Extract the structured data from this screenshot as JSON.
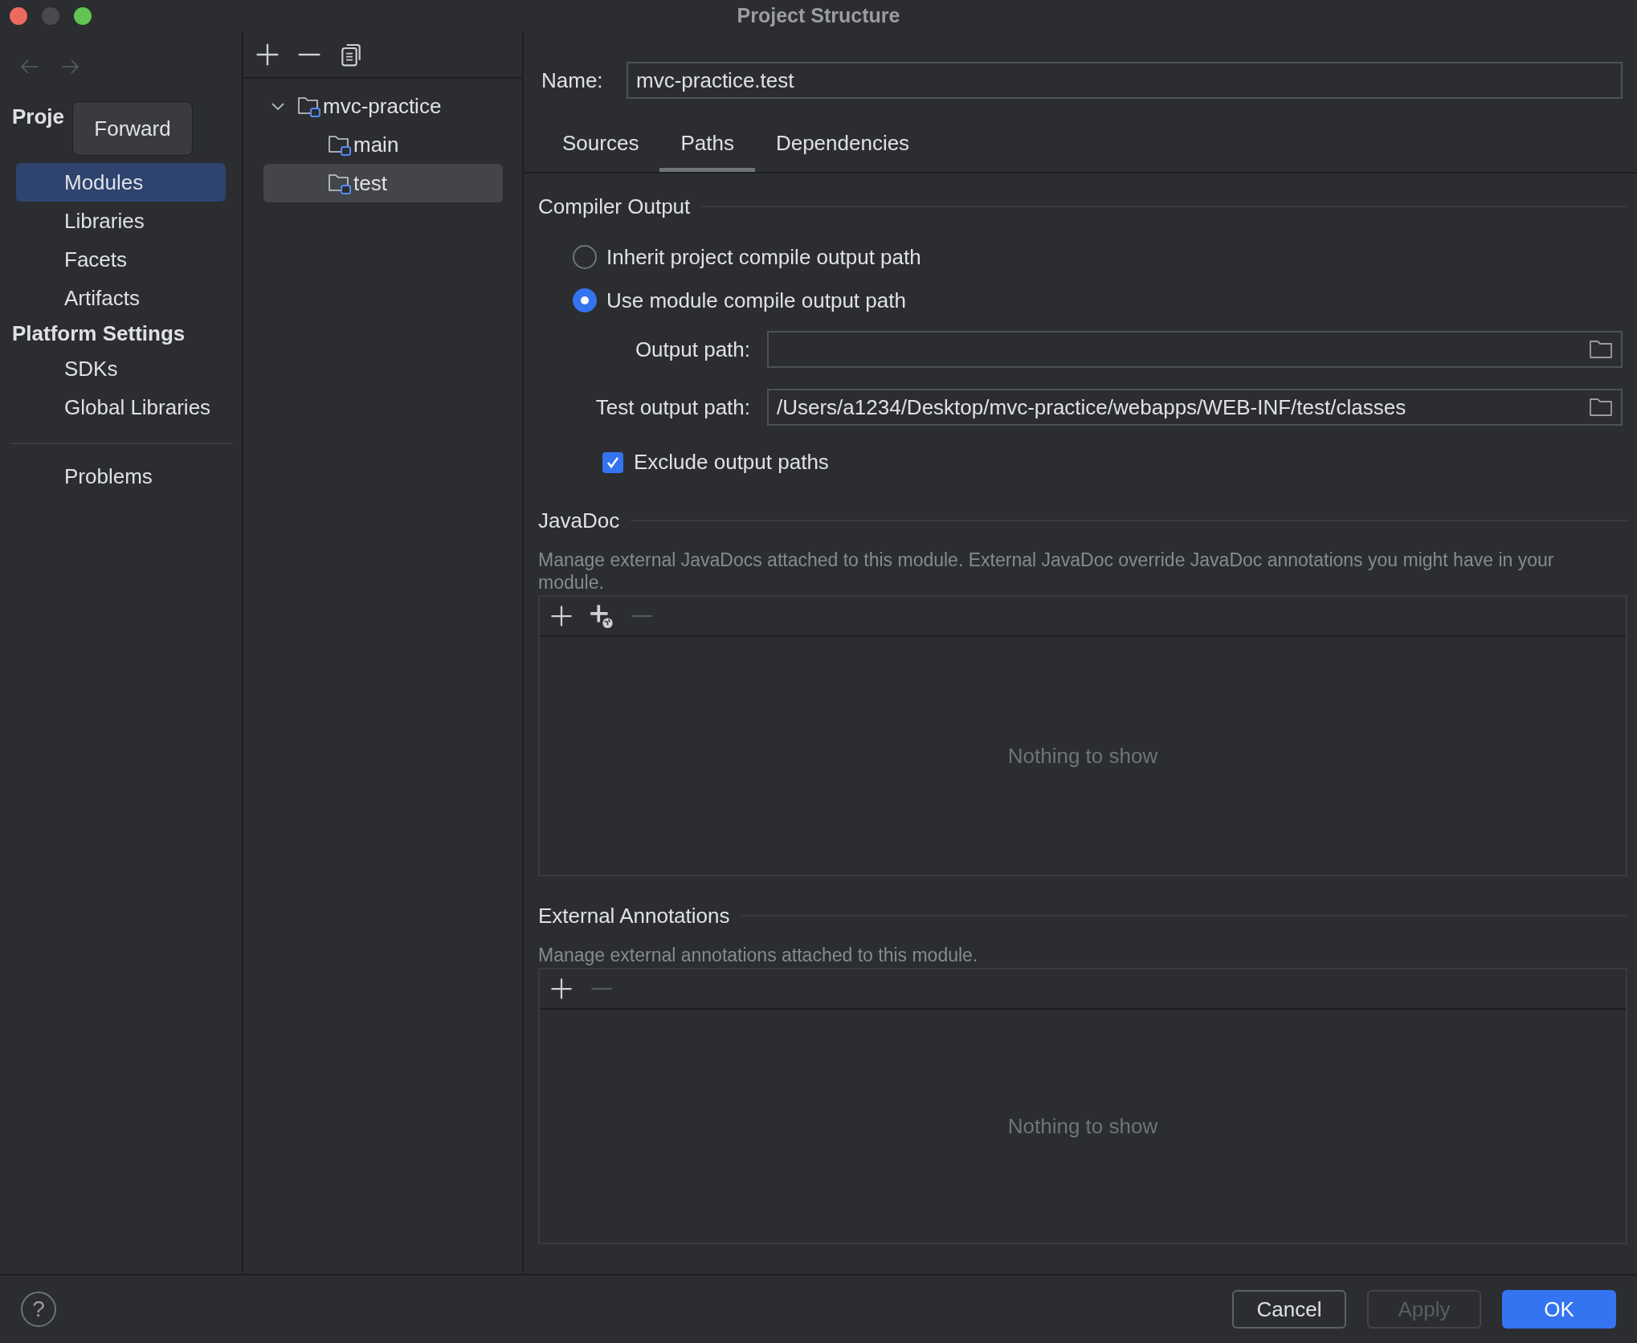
{
  "window": {
    "title": "Project Structure"
  },
  "nav": [
    {
      "kind": "back",
      "disabled": true
    },
    {
      "kind": "forward",
      "disabled": true
    }
  ],
  "tooltip": "Forward",
  "sidebar": {
    "sections": [
      {
        "header": "Proje",
        "items": [
          {
            "label": "Modules",
            "selected": true
          },
          {
            "label": "Libraries",
            "selected": false
          },
          {
            "label": "Facets",
            "selected": false
          },
          {
            "label": "Artifacts",
            "selected": false
          }
        ]
      },
      {
        "header": "Platform Settings",
        "items": [
          {
            "label": "SDKs",
            "selected": false
          },
          {
            "label": "Global Libraries",
            "selected": false
          }
        ]
      }
    ],
    "footer_items": [
      {
        "label": "Problems",
        "selected": false
      }
    ]
  },
  "tree": {
    "toolbar": [
      {
        "kind": "add",
        "disabled": false
      },
      {
        "kind": "remove",
        "disabled": false
      },
      {
        "kind": "copy",
        "disabled": false
      }
    ],
    "nodes": [
      {
        "label": "mvc-practice",
        "expanded": true,
        "selected": false,
        "children": [
          {
            "label": "main",
            "selected": false
          },
          {
            "label": "test",
            "selected": true
          }
        ]
      }
    ]
  },
  "name_field": {
    "label": "Name:",
    "value": "mvc-practice.test"
  },
  "tabs": [
    {
      "label": "Sources",
      "selected": false
    },
    {
      "label": "Paths",
      "selected": true
    },
    {
      "label": "Dependencies",
      "selected": false
    }
  ],
  "compiler_output": {
    "title": "Compiler Output",
    "options": [
      {
        "label": "Inherit project compile output path",
        "selected": false
      },
      {
        "label": "Use module compile output path",
        "selected": true
      }
    ],
    "fields": [
      {
        "label": "Output path:"
      },
      {
        "label": "Test output path:",
        "value": "/Users/a1234/Desktop/mvc-practice/webapps/WEB-INF/test/classes"
      }
    ],
    "checkbox": {
      "label": "Exclude output paths",
      "checked": true
    }
  },
  "panels": [
    {
      "title": "JavaDoc",
      "description": "Manage external JavaDocs attached to this module. External JavaDoc override JavaDoc annotations you might have in your module.",
      "toolbar": [
        {
          "kind": "add",
          "disabled": false
        },
        {
          "kind": "add-web",
          "disabled": false
        },
        {
          "kind": "remove",
          "disabled": true
        }
      ],
      "empty_text": "Nothing to show"
    },
    {
      "title": "External Annotations",
      "description": "Manage external annotations attached to this module.",
      "toolbar": [
        {
          "kind": "add",
          "disabled": false
        },
        {
          "kind": "remove",
          "disabled": true
        }
      ],
      "empty_text": "Nothing to show"
    }
  ],
  "help": "?",
  "buttons": [
    {
      "label": "Cancel",
      "disabled": false,
      "primary": false
    },
    {
      "label": "Apply",
      "disabled": true,
      "primary": false
    },
    {
      "label": "OK",
      "disabled": false,
      "primary": true
    }
  ]
}
